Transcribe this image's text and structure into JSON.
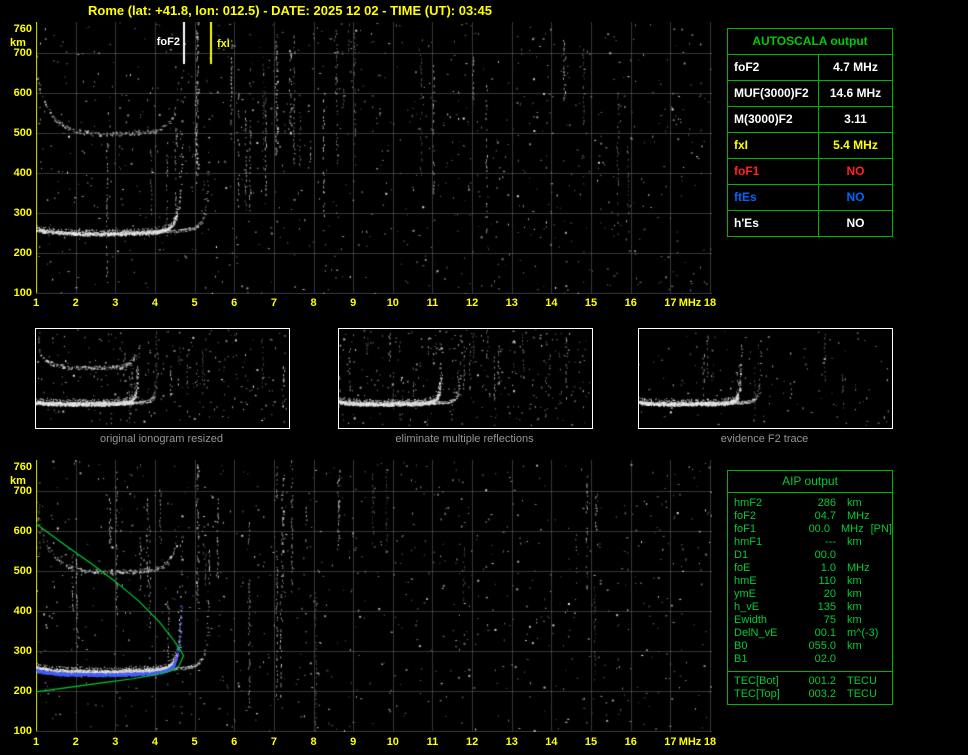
{
  "title": "Rome (lat: +41.8, lon: 012.5) - DATE: 2025 12 02 - TIME (UT): 03:45",
  "colors": {
    "background": "#000000",
    "axis_text": "#ffff00",
    "grid": "#555555",
    "table_border": "#00b400",
    "table_header_text": "#00cc00",
    "aip_text": "#00cc33",
    "caption_text": "#969696",
    "value_white": "#ffffff",
    "value_yellow": "#ffff00",
    "value_red": "#ff2222",
    "value_blue": "#0066ff",
    "profile_green": "#00cc33",
    "restored_trace_blue": "#4666ff"
  },
  "ionogram": {
    "f_axis": {
      "unit": "MHz",
      "min": 1,
      "max": 18,
      "ticks": [
        1,
        2,
        3,
        4,
        5,
        6,
        7,
        8,
        9,
        10,
        11,
        12,
        13,
        14,
        15,
        16,
        17,
        18
      ]
    },
    "h_axis": {
      "unit": "km",
      "min": 100,
      "max": 760,
      "ticks": [
        760,
        700,
        600,
        500,
        400,
        300,
        200,
        100
      ]
    },
    "markers": [
      {
        "label": "foF2",
        "f": 4.7,
        "color": "#ffffff"
      },
      {
        "label": "fxI",
        "f": 5.4,
        "color": "#ffff00"
      }
    ],
    "trace_model": {
      "fc_o": 4.75,
      "fc_x": 5.45,
      "h0": 247,
      "a1": 3.0,
      "a2": 1.5,
      "low_tail": 12,
      "hop2_tail": 120
    },
    "profile_topside": [
      [
        1.0,
        618
      ],
      [
        1.3,
        596
      ],
      [
        1.8,
        560
      ],
      [
        2.4,
        518
      ],
      [
        3.0,
        474
      ],
      [
        3.6,
        424
      ],
      [
        4.1,
        374
      ],
      [
        4.45,
        330
      ],
      [
        4.65,
        302
      ],
      [
        4.72,
        288
      ]
    ],
    "profile_bottomside": [
      [
        4.72,
        288
      ],
      [
        4.6,
        262
      ],
      [
        4.4,
        250
      ],
      [
        4.0,
        240
      ],
      [
        3.4,
        230
      ],
      [
        2.8,
        222
      ],
      [
        2.2,
        214
      ],
      [
        1.6,
        206
      ],
      [
        1.0,
        198
      ]
    ]
  },
  "autoscala_table": {
    "title": "AUTOSCALA output",
    "rows": [
      {
        "label": "foF2",
        "value": "4.7 MHz",
        "color": "#ffffff"
      },
      {
        "label": "MUF(3000)F2",
        "value": "14.6 MHz",
        "color": "#ffffff"
      },
      {
        "label": "M(3000)F2",
        "value": "3.11",
        "color": "#ffffff"
      },
      {
        "label": "fxI",
        "value": "5.4 MHz",
        "color": "#ffff00"
      },
      {
        "label": "foF1",
        "value": "NO",
        "color": "#ff2222"
      },
      {
        "label": "ftEs",
        "value": "NO",
        "color": "#0066ff"
      },
      {
        "label": "h'Es",
        "value": "NO",
        "color": "#ffffff"
      }
    ]
  },
  "thumbnails": [
    {
      "caption": "original ionogram resized"
    },
    {
      "caption": "eliminate multiple reflections"
    },
    {
      "caption": "evidence F2 trace"
    }
  ],
  "aip_table": {
    "title": "AIP output",
    "rows": [
      {
        "label": "hmF2",
        "value": "286",
        "unit": "km",
        "extra": ""
      },
      {
        "label": "foF2",
        "value": "04.7",
        "unit": "MHz",
        "extra": ""
      },
      {
        "label": "foF1",
        "value": "00.0",
        "unit": "MHz",
        "extra": "[PN]"
      },
      {
        "label": "hmF1",
        "value": "---",
        "unit": "km",
        "extra": ""
      },
      {
        "label": "D1",
        "value": "00.0",
        "unit": "",
        "extra": ""
      },
      {
        "label": "foE",
        "value": "1.0",
        "unit": "MHz",
        "extra": ""
      },
      {
        "label": "hmE",
        "value": "110",
        "unit": "km",
        "extra": ""
      },
      {
        "label": "ymE",
        "value": "20",
        "unit": "km",
        "extra": ""
      },
      {
        "label": "h_vE",
        "value": "135",
        "unit": "km",
        "extra": ""
      },
      {
        "label": "Ewidth",
        "value": "75",
        "unit": "km",
        "extra": ""
      },
      {
        "label": "DelN_vE",
        "value": "00.1",
        "unit": "m^(-3)",
        "extra": ""
      },
      {
        "label": "B0",
        "value": "055.0",
        "unit": "km",
        "extra": ""
      },
      {
        "label": "B1",
        "value": "02.0",
        "unit": "",
        "extra": ""
      }
    ],
    "tec_rows": [
      {
        "label": "TEC[Bot]",
        "value": "001.2",
        "unit": "TECU"
      },
      {
        "label": "TEC[Top]",
        "value": "003.2",
        "unit": "TECU"
      }
    ]
  }
}
